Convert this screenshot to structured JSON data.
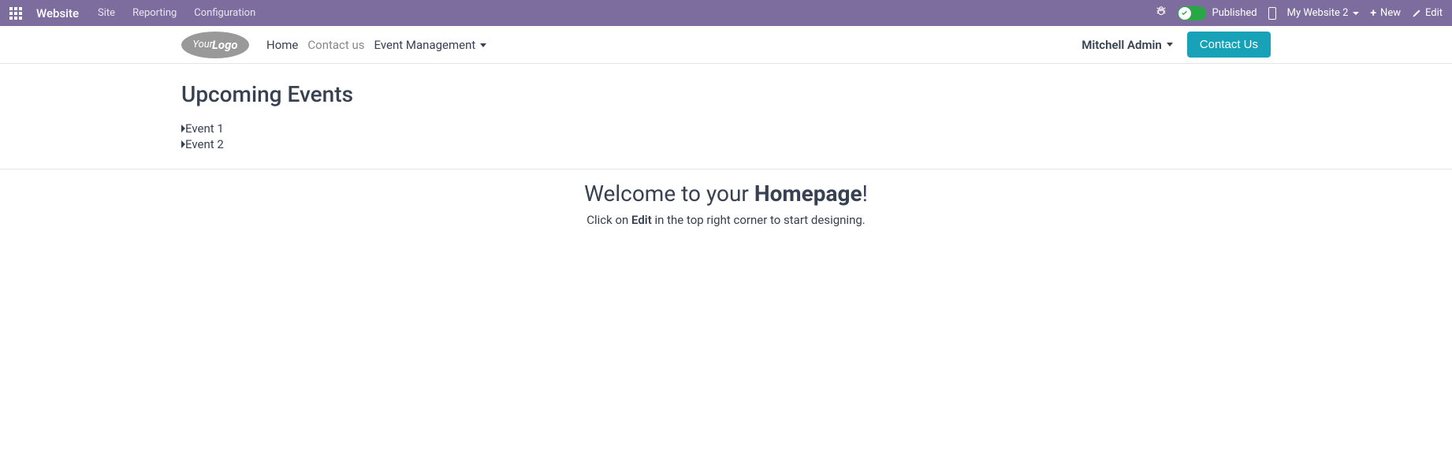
{
  "topbar": {
    "title": "Website",
    "menu": [
      {
        "label": "Site"
      },
      {
        "label": "Reporting"
      },
      {
        "label": "Configuration"
      }
    ],
    "published_label": "Published",
    "website_selector": "My Website 2",
    "new_label": "New",
    "edit_label": "Edit"
  },
  "header": {
    "logo_your": "Your",
    "logo_logo": "Logo",
    "nav": [
      {
        "label": "Home",
        "active": true
      },
      {
        "label": "Contact us",
        "muted": true
      },
      {
        "label": "Event Management",
        "dropdown": true
      }
    ],
    "user": "Mitchell Admin",
    "contact_btn": "Contact Us"
  },
  "content": {
    "events_title": "Upcoming Events",
    "events": [
      {
        "label": "Event 1"
      },
      {
        "label": "Event 2"
      }
    ],
    "welcome_prefix": "Welcome to your ",
    "welcome_strong": "Homepage",
    "welcome_suffix": "!",
    "welcome_sub_prefix": "Click on ",
    "welcome_sub_edit": "Edit",
    "welcome_sub_suffix": " in the top right corner to start designing."
  }
}
